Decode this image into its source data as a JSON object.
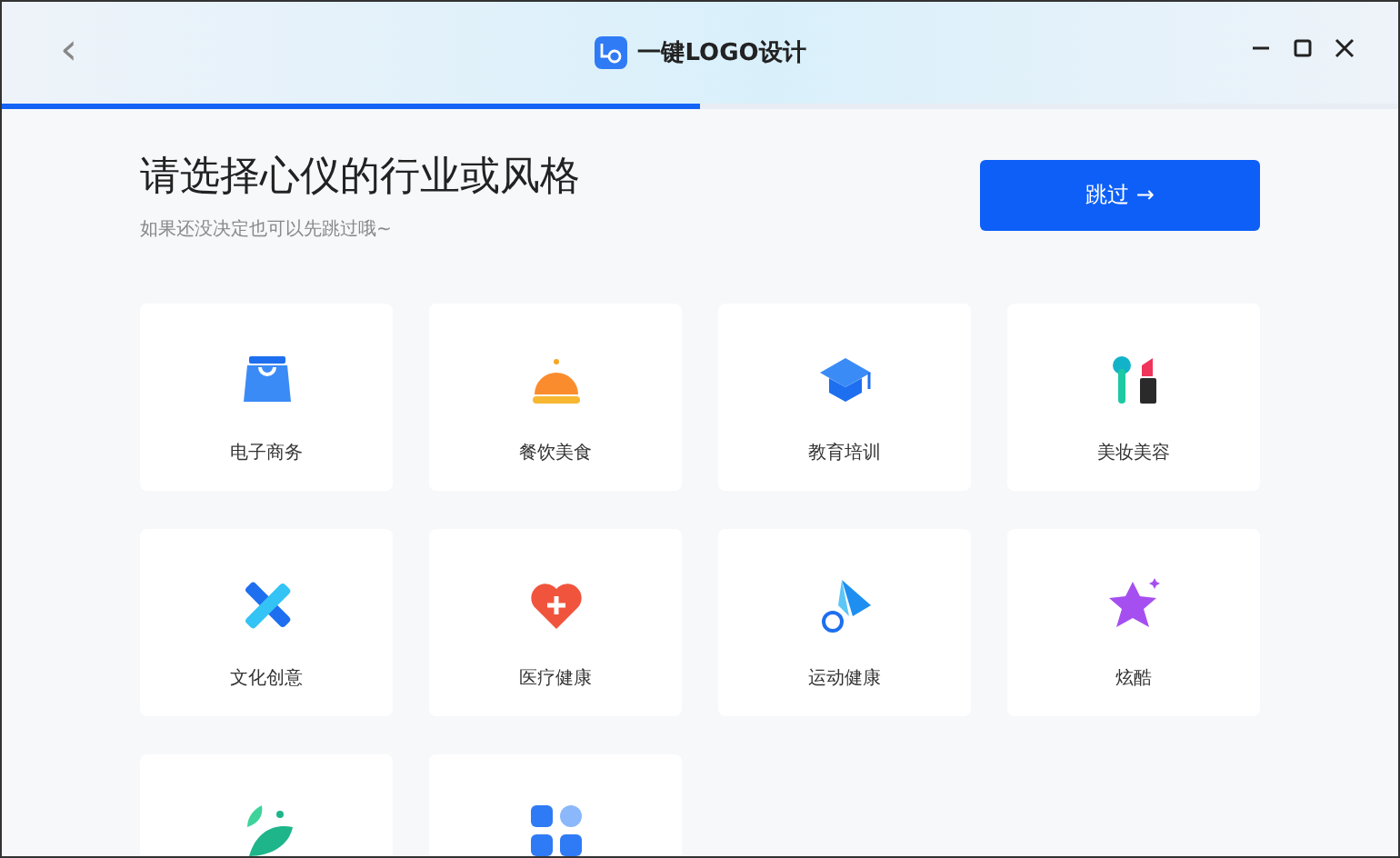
{
  "window": {
    "title": "一键LOGO设计",
    "back": "‹"
  },
  "progress": {
    "level": 0.5
  },
  "heading": {
    "title": "请选择心仪的行业或风格",
    "subtitle": "如果还没决定也可以先跳过哦~"
  },
  "skip_button": {
    "label": "跳过 →"
  },
  "categories": [
    {
      "kind": "labeled",
      "label": "电子商务"
    },
    {
      "kind": "labeled",
      "label": "餐饮美食"
    },
    {
      "kind": "labeled",
      "label": "教育培训"
    },
    {
      "kind": "labeled",
      "label": "美妆美容"
    },
    {
      "kind": "labeled",
      "label": "文化创意"
    },
    {
      "kind": "labeled",
      "label": "医疗健康"
    },
    {
      "kind": "labeled",
      "label": "运动健康"
    },
    {
      "kind": "labeled",
      "label": "炫酷"
    },
    {
      "kind": "cut_off"
    },
    {
      "kind": "cut_off"
    }
  ]
}
